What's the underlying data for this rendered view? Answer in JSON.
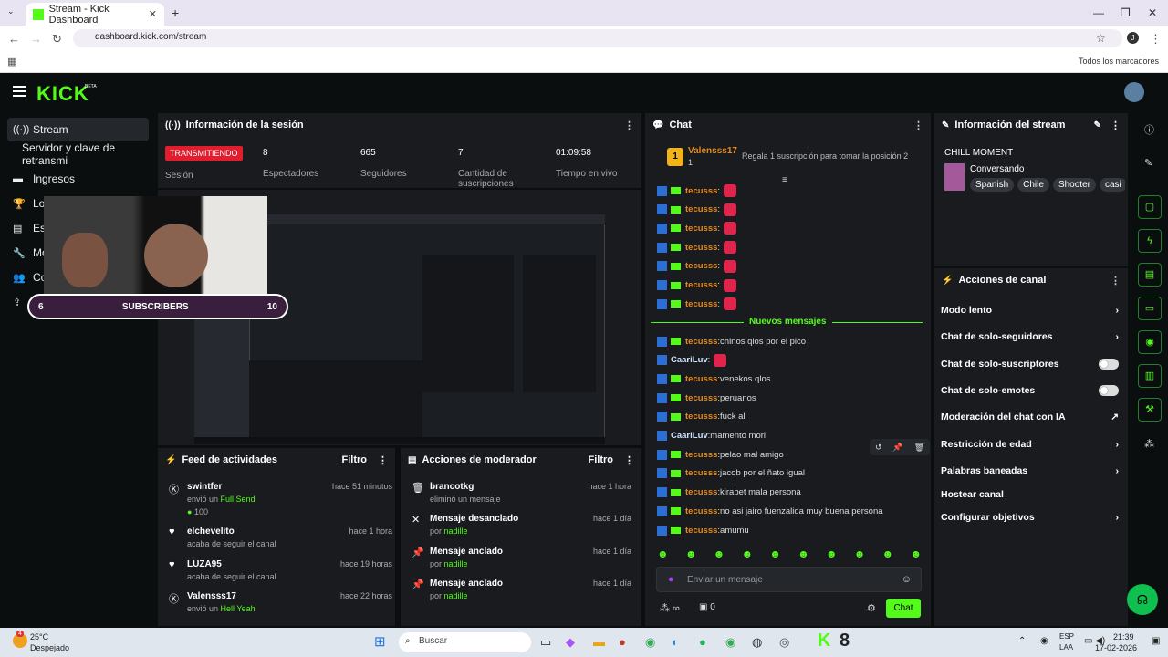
{
  "browser": {
    "tab_title": "Stream - Kick Dashboard",
    "url": "dashboard.kick.com/stream",
    "bookmarks": "Todos los marcadores",
    "profile_initial": "J"
  },
  "brand": {
    "logo": "KICK",
    "beta": "BETA"
  },
  "sidebar": {
    "items": [
      {
        "label": "Stream",
        "icon": "broadcast-icon"
      },
      {
        "label": "Servidor y clave de retransmi",
        "icon": ""
      },
      {
        "label": "Ingresos",
        "icon": "money-icon"
      },
      {
        "label": "Lo",
        "icon": "trophy-icon"
      },
      {
        "label": "Es",
        "icon": "stats-icon"
      },
      {
        "label": "Mo",
        "icon": "wrench-icon"
      },
      {
        "label": "Co",
        "icon": "users-icon"
      },
      {
        "label": "",
        "icon": "upload-icon"
      }
    ]
  },
  "session": {
    "title": "Información de la sesión",
    "status": "TRANSMITIENDO",
    "status_label": "Sesión",
    "stats": [
      {
        "value": "8",
        "label": "Espectadores"
      },
      {
        "value": "665",
        "label": "Seguidores"
      },
      {
        "value": "7",
        "label": "Cantidad de suscripciones"
      },
      {
        "value": "01:09:58",
        "label": "Tiempo en vivo"
      }
    ]
  },
  "preview": {
    "title_fragment": "n",
    "sub_left": "6",
    "sub_label": "SUBSCRIBERS",
    "sub_right": "10"
  },
  "feed": {
    "title": "Feed de actividades",
    "filter": "Filtro",
    "items": [
      {
        "name": "swintfer",
        "action": "envió un",
        "highlight": "Full Send",
        "extra": "100",
        "time": "hace 51 minutos",
        "icon": "kick-icon"
      },
      {
        "name": "elchevelito",
        "action": "acaba de seguir el canal",
        "time": "hace 1 hora",
        "icon": "heart-icon"
      },
      {
        "name": "LUZA95",
        "action": "acaba de seguir el canal",
        "time": "hace 19 horas",
        "icon": "heart-icon"
      },
      {
        "name": "Valensss17",
        "action": "envió un",
        "highlight": "Hell Yeah",
        "time": "hace 22 horas",
        "icon": "kick-icon"
      }
    ]
  },
  "mod": {
    "title": "Acciones de moderador",
    "filter": "Filtro",
    "items": [
      {
        "name": "brancotkg",
        "sub": "eliminó un mensaje",
        "time": "hace 1 hora",
        "icon": "trash-icon"
      },
      {
        "name": "Mensaje desanclado",
        "sub": "por",
        "by": "nadille",
        "time": "hace 1 día",
        "icon": "unpin-icon"
      },
      {
        "name": "Mensaje anclado",
        "sub": "por",
        "by": "nadille",
        "time": "hace 1 día",
        "icon": "pin-icon"
      },
      {
        "name": "Mensaje anclado",
        "sub": "por",
        "by": "nadille",
        "time": "hace 1 día",
        "icon": "pin-icon"
      }
    ]
  },
  "chat": {
    "title": "Chat",
    "top_user": "Valensss17",
    "top_count": "1",
    "top_rank": "1",
    "gift_text": "Regala 1 suscripción para tomar la posición 2",
    "new_messages": "Nuevos mensajes",
    "input_placeholder": "Enviar un mensaje",
    "send": "Chat",
    "viewer_count": "0",
    "lines": [
      {
        "user": "tecusss",
        "msg": "",
        "emote": true
      },
      {
        "user": "tecusss",
        "msg": "",
        "emote": true
      },
      {
        "user": "tecusss",
        "msg": "",
        "emote": true
      },
      {
        "user": "tecusss",
        "msg": "",
        "emote": true
      },
      {
        "user": "tecusss",
        "msg": "",
        "emote": true
      },
      {
        "user": "tecusss",
        "msg": "",
        "emote": true
      },
      {
        "user": "tecusss",
        "msg": "",
        "emote": true
      }
    ],
    "new_lines": [
      {
        "user": "tecusss",
        "msg": "chinos qlos por el pico"
      },
      {
        "user": "CaariLuv",
        "msg": "",
        "emote": true
      },
      {
        "user": "tecusss",
        "msg": "venekos qlos"
      },
      {
        "user": "tecusss",
        "msg": "peruanos"
      },
      {
        "user": "tecusss",
        "msg": "fuck all"
      },
      {
        "user": "CaariLuv",
        "msg": "mamento mori"
      },
      {
        "user": "tecusss",
        "msg": "pelao mal amigo"
      },
      {
        "user": "tecusss",
        "msg": "jacob por el ñato igual"
      },
      {
        "user": "tecusss",
        "msg": "kirabet mala persona"
      },
      {
        "user": "tecusss",
        "msg": "no asi jairo fuenzalida muy buena persona"
      },
      {
        "user": "tecusss",
        "msg": "amumu"
      }
    ]
  },
  "stream_info": {
    "title": "Información del stream",
    "stream_title": "CHILL MOMENT",
    "category": "Conversando",
    "tags": [
      "Spanish",
      "Chile",
      "Shooter",
      "casi"
    ]
  },
  "channel_actions": {
    "title": "Acciones de canal",
    "items": [
      {
        "label": "Modo lento",
        "kind": "arrow"
      },
      {
        "label": "Chat de solo-seguidores",
        "kind": "arrow"
      },
      {
        "label": "Chat de solo-suscriptores",
        "kind": "toggle"
      },
      {
        "label": "Chat de solo-emotes",
        "kind": "toggle"
      },
      {
        "label": "Moderación del chat con IA",
        "kind": "link"
      },
      {
        "label": "Restricción de edad",
        "kind": "arrow"
      },
      {
        "label": "Palabras baneadas",
        "kind": "arrow"
      },
      {
        "label": "Hostear canal",
        "kind": "none"
      },
      {
        "label": "Configurar objetivos",
        "kind": "arrow"
      }
    ]
  },
  "taskbar": {
    "weather_temp": "25°C",
    "weather_desc": "Despejado",
    "search": "Buscar",
    "lang": "ESP",
    "lang2": "LAA",
    "time": "21:39",
    "date": "17-02-2026",
    "badge": "4"
  },
  "colors": {
    "brand": "#53fc18",
    "live": "#e11d2e",
    "panel": "#191b1f"
  }
}
